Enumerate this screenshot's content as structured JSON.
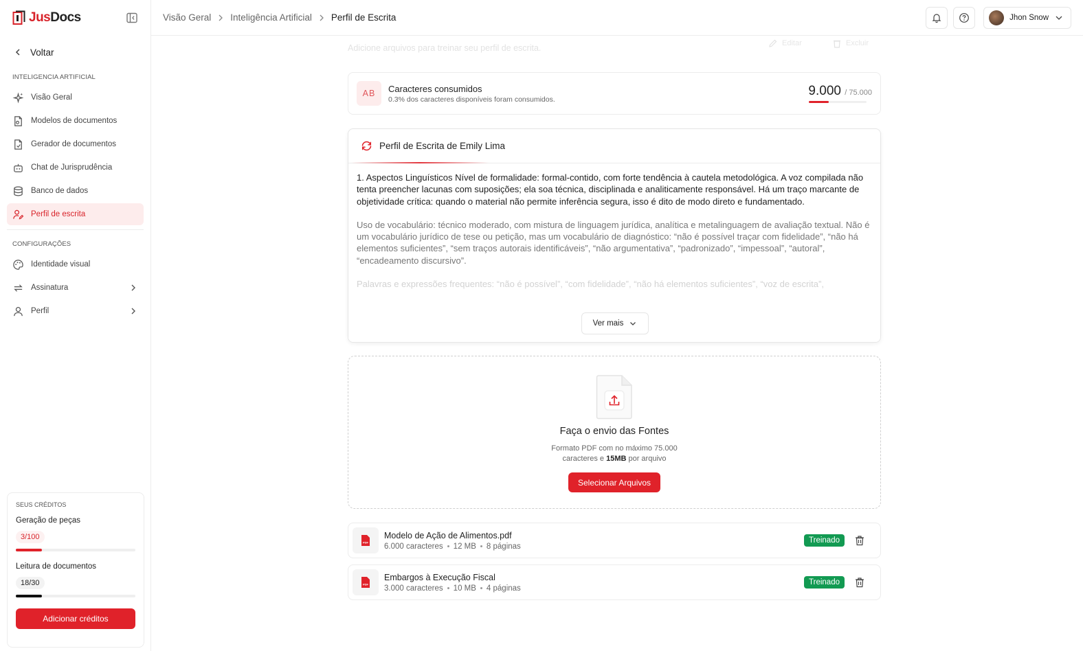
{
  "brand": {
    "name_part1": "Jus",
    "name_part2": "Docs",
    "accent": "#e0222a"
  },
  "sidebar": {
    "back_label": "Voltar",
    "section_ai": "INTELIGENCIA ARTIFICIAL",
    "ai_items": [
      {
        "label": "Visão Geral",
        "icon": "sparkles-icon"
      },
      {
        "label": "Modelos de documentos",
        "icon": "document-icon"
      },
      {
        "label": "Gerador de documentos",
        "icon": "document-gear-icon"
      },
      {
        "label": "Chat de Jurisprudência",
        "icon": "robot-icon"
      },
      {
        "label": "Banco de dados",
        "icon": "database-icon"
      },
      {
        "label": "Perfil de escrita",
        "icon": "user-pen-icon",
        "active": true
      }
    ],
    "section_config": "CONFIGURAÇÕES",
    "config_items": [
      {
        "label": "Identidade visual",
        "icon": "palette-icon"
      },
      {
        "label": "Assinatura",
        "icon": "repeat-icon"
      },
      {
        "label": "Perfil",
        "icon": "user-icon"
      }
    ],
    "credits": {
      "title": "SEUS CRÉDITOS",
      "pieces_label": "Geração de peças",
      "pieces_value": "3/100",
      "pieces_progress": 0.22,
      "reading_label": "Leitura de documentos",
      "reading_value": "18/30",
      "reading_progress": 0.22,
      "add_button": "Adicionar créditos"
    }
  },
  "header": {
    "breadcrumbs": [
      "Visão Geral",
      "Inteligência Artificial",
      "Perfil de Escrita"
    ],
    "user_name": "Jhon Snow"
  },
  "main": {
    "hint": "Adicione arquivos para treinar seu perfil de escrita.",
    "edit_label": "Editar",
    "delete_label": "Excluir",
    "usage": {
      "badge": "AB",
      "title": "Caracteres consumidos",
      "subtitle": "0.3% dos caracteres disponíveis foram consumidos.",
      "used": "9.000",
      "total": "/ 75.000"
    },
    "profile": {
      "title": "Perfil de Escrita de Emily Lima",
      "paragraph1": "1. Aspectos Linguísticos Nível de formalidade: formal-contido, com forte tendência à cautela metodológica. A voz compilada não tenta preencher lacunas com suposições; ela soa técnica, disciplinada e analiticamente responsável. Há um traço marcante de objetividade crítica: quando o material não permite inferência segura, isso é dito de modo direto e fundamentado.",
      "paragraph2": "Uso de vocabulário: técnico moderado, com mistura de linguagem jurídica, analítica e metalinguagem de avaliação textual. Não é um vocabulário jurídico de tese ou petição, mas um vocabulário de diagnóstico: “não é possível traçar com fidelidade”, “não há elementos suficientes”, “sem traços autorais identificáveis”, “não argumentativa”, “padronizado”, “impessoal”, “autoral”, “encadeamento discursivo”.",
      "paragraph3": "Palavras e expressões frequentes: “não é possível”, “com fidelidade”, “não há elementos suficientes”, “voz de escrita”,",
      "see_more": "Ver mais"
    },
    "upload": {
      "title": "Faça o envio das Fontes",
      "sub_line1": "Formato PDF com no máximo 75.000",
      "sub_line2a": "caracteres e ",
      "sub_line2b": "15MB",
      "sub_line2c": " por arquivo",
      "button": "Selecionar Arquivos"
    },
    "files": [
      {
        "name": "Modelo de Ação de Alimentos.pdf",
        "chars": "6.000 caracteres",
        "size": "12 MB",
        "pages": "8 páginas",
        "status": "Treinado"
      },
      {
        "name": "Embargos à Execução Fiscal",
        "chars": "3.000 caracteres",
        "size": "10 MB",
        "pages": "4 páginas",
        "status": "Treinado"
      }
    ]
  }
}
